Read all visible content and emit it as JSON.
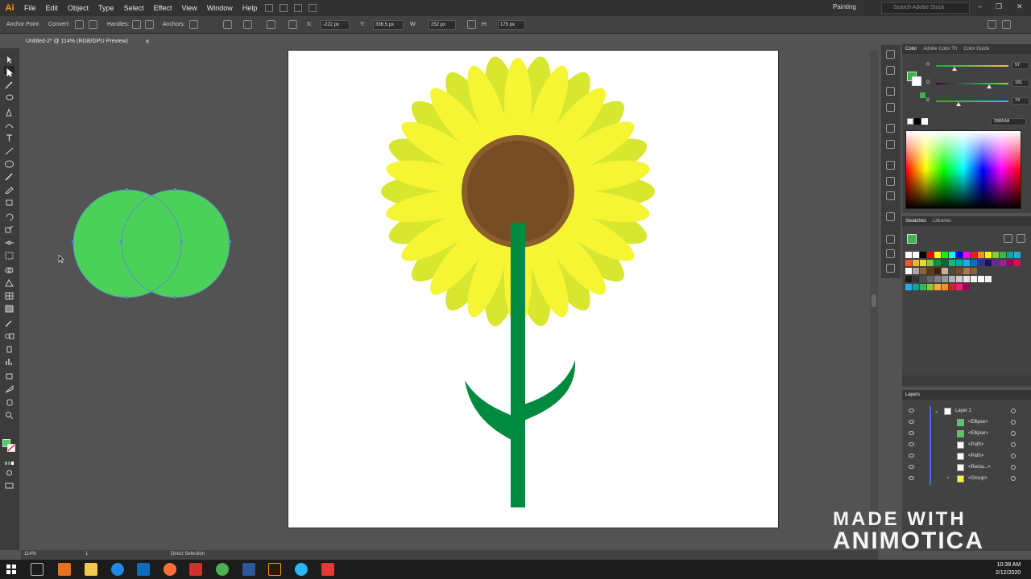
{
  "app": {
    "logo": "Ai",
    "workspace": "Painting",
    "stock_search_placeholder": "Search Adobe Stock"
  },
  "menu": [
    "File",
    "Edit",
    "Object",
    "Type",
    "Select",
    "Effect",
    "View",
    "Window",
    "Help"
  ],
  "controlbar": {
    "anchor_point": "Anchor Point",
    "convert": "Convert:",
    "handles": "Handles:",
    "anchors": "Anchors:",
    "x_value": "-222 px",
    "y_value": "336.5 px",
    "w_label": "W:",
    "w_value": "252 px",
    "h_label": "H:",
    "h_value": "175 px"
  },
  "document": {
    "tab_title": "Untitled-2* @ 114% (RGB/GPU Preview)"
  },
  "statusbar": {
    "zoom": "114%",
    "artboard_num": "1",
    "tool": "Direct Selection"
  },
  "color_panel": {
    "tabs": [
      "Color",
      "Adobe Color Th",
      "Color Guide"
    ],
    "r_label": "R",
    "r_value": "57",
    "g_label": "G",
    "g_value": "181",
    "b_label": "B",
    "b_value": "74",
    "hex": "39B54A",
    "fill_color": "#39B54A"
  },
  "swatches_panel": {
    "tabs": [
      "Swatches",
      "Libraries"
    ]
  },
  "layers_panel": {
    "title": "Layers",
    "items": [
      {
        "name": "Layer 1"
      },
      {
        "name": "<Ellipse>"
      },
      {
        "name": "<Ellipse>"
      },
      {
        "name": "<Path>"
      },
      {
        "name": "<Path>"
      },
      {
        "name": "<Recta...>"
      },
      {
        "name": "<Group>"
      }
    ]
  },
  "watermark": {
    "line1": "MADE WITH",
    "line2": "ANIMOTICA"
  },
  "clock": {
    "time": "10:38 AM",
    "date": "2/12/2020"
  },
  "colors": {
    "circle_fill": "#4bd05a",
    "petal_light": "#f6f534",
    "petal_dark": "#d7e62f",
    "center": "#754c24",
    "center_ring": "#8b5e2e",
    "stem": "#008a40"
  }
}
